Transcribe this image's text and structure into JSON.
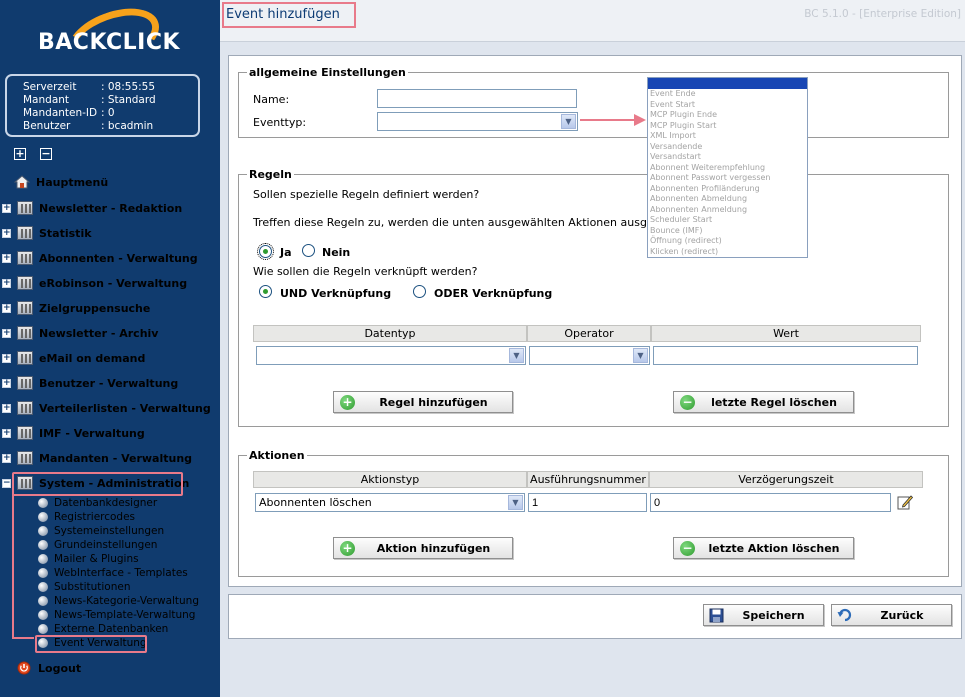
{
  "brand": {
    "logo_text": "BACKCLICK"
  },
  "server_info": [
    {
      "key": "Serverzeit",
      "value": ": 08:55:55"
    },
    {
      "key": "Mandant",
      "value": ": Standard"
    },
    {
      "key": "Mandanten-ID",
      "value": ": 0"
    },
    {
      "key": "Benutzer",
      "value": ": bcadmin"
    }
  ],
  "expand_controls": {
    "expand": "+",
    "collapse": "−"
  },
  "menu": {
    "home": "Hauptmenü",
    "items": [
      "Newsletter - Redaktion",
      "Statistik",
      "Abonnenten - Verwaltung",
      "eRobinson - Verwaltung",
      "Zielgruppensuche",
      "Newsletter - Archiv",
      "eMail on demand",
      "Benutzer - Verwaltung",
      "Verteilerlisten - Verwaltung",
      "IMF - Verwaltung",
      "Mandanten - Verwaltung"
    ],
    "expanded": "System - Administration",
    "subitems": [
      "Datenbankdesigner",
      "Registriercodes",
      "Systemeinstellungen",
      "Grundeinstellungen",
      "Mailer & Plugins",
      "WebInterface - Templates",
      "Substitutionen",
      "News-Kategorie-Verwaltung",
      "News-Template-Verwaltung",
      "Externe Datenbanken",
      "Event Verwaltung"
    ],
    "logout": "Logout"
  },
  "page": {
    "title": "Event hinzufügen",
    "version": "BC 5.1.0 - [Enterprise Edition]"
  },
  "general": {
    "legend": "allgemeine Einstellungen",
    "name_label": "Name:",
    "name_value": "",
    "eventtype_label": "Eventtyp:",
    "eventtype_value": ""
  },
  "eventtype_options": [
    "",
    "Event Ende",
    "Event Start",
    "MCP Plugin Ende",
    "MCP Plugin Start",
    "XML Import",
    "Versandende",
    "Versandstart",
    "Abonnent Weiterempfehlung",
    "Abonnent Passwort vergessen",
    "Abonnenten Profiländerung",
    "Abonnenten Abmeldung",
    "Abonnenten Anmeldung",
    "Scheduler Start",
    "Bounce (IMF)",
    "Öffnung (redirect)",
    "Klicken (redirect)"
  ],
  "rules": {
    "legend": "Regeln",
    "question": "Sollen spezielle Regeln definiert werden?",
    "info": "Treffen diese Regeln zu, werden die unten ausgewählten Aktionen ausgeführt.",
    "yes": "Ja",
    "no": "Nein",
    "link_question": "Wie sollen die Regeln verknüpft werden?",
    "and_label": "UND Verknüpfung",
    "or_label": "ODER Verknüpfung",
    "columns": [
      "Datentyp",
      "Operator",
      "Wert"
    ],
    "add_button": "Regel hinzufügen",
    "delete_button": "letzte Regel löschen"
  },
  "actions": {
    "legend": "Aktionen",
    "columns": [
      "Aktionstyp",
      "Ausführungsnummer",
      "Verzögerungszeit"
    ],
    "row": {
      "type": "Abonnenten löschen",
      "number": "1",
      "delay": "0"
    },
    "add_button": "Aktion hinzufügen",
    "delete_button": "letzte Aktion löschen"
  },
  "footer": {
    "save": "Speichern",
    "back": "Zurück"
  },
  "colors": {
    "sidebar": "#103b6e",
    "highlight": "#e87a8a",
    "accent": "#f7a21b",
    "selected": "#1846b4"
  }
}
